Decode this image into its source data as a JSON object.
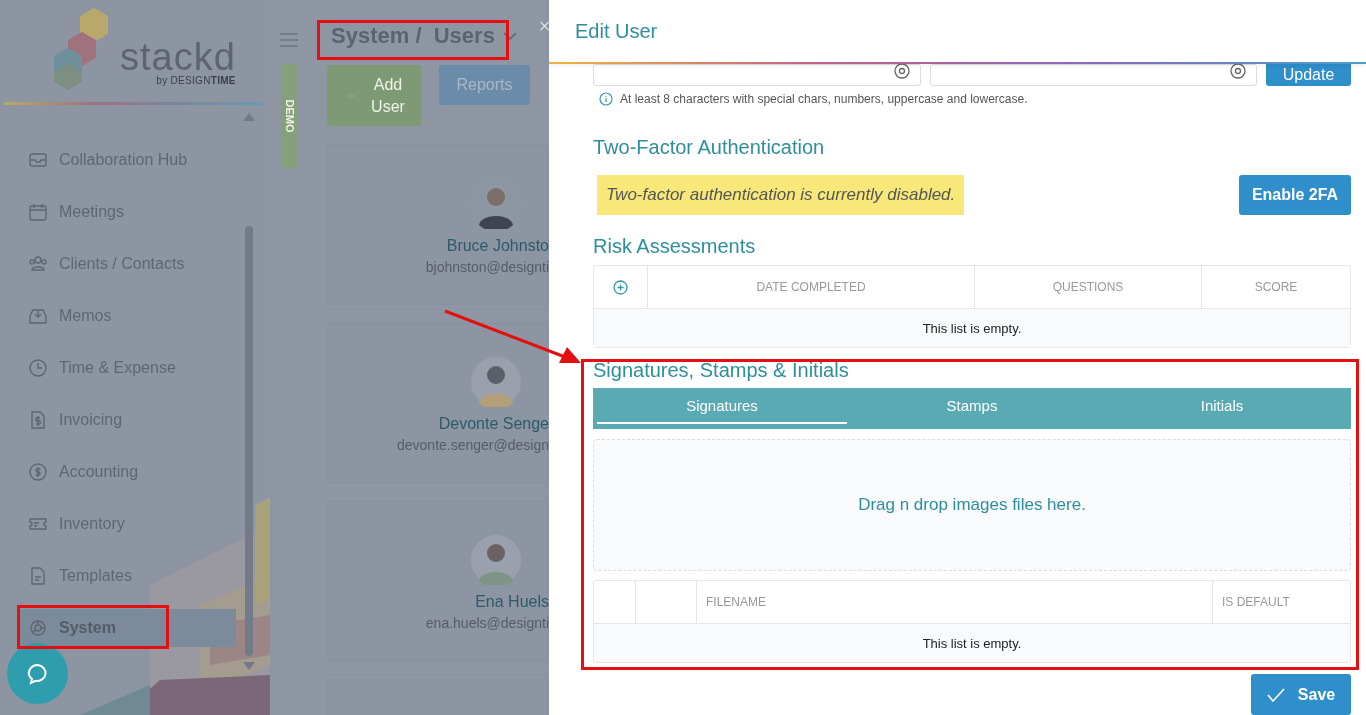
{
  "sidebar": {
    "logo": {
      "name": "stackd",
      "byline": "by DESIGN**TIME**"
    },
    "items": [
      {
        "label": "Collaboration Hub",
        "selected": false
      },
      {
        "label": "Meetings",
        "selected": false
      },
      {
        "label": "Clients / Contacts",
        "selected": false
      },
      {
        "label": "Memos",
        "selected": false
      },
      {
        "label": "Time & Expense",
        "selected": false
      },
      {
        "label": "Invoicing",
        "selected": false
      },
      {
        "label": "Accounting",
        "selected": false
      },
      {
        "label": "Inventory",
        "selected": false
      },
      {
        "label": "Templates",
        "selected": false
      },
      {
        "label": "System",
        "selected": true
      }
    ]
  },
  "demo_tab": "DEMO",
  "breadcrumb": "System /  Users",
  "buttons": [
    {
      "label": "Add User",
      "kind": "add"
    },
    {
      "label": "Reports",
      "kind": "plain"
    }
  ],
  "users": [
    {
      "name": "Bruce Johnsto",
      "email": "bjohnston@designti"
    },
    {
      "name": "Devonte Senge",
      "email": "devonte.senger@design"
    },
    {
      "name": "Ena Huels",
      "email": "ena.huels@designti"
    }
  ],
  "drawer": {
    "title": "Edit User",
    "update_button": "Update",
    "password_hint": "At least 8 characters with special chars, numbers, uppercase and lowercase.",
    "two_factor": {
      "heading": "Two-Factor Authentication",
      "status": "Two-factor authentication is currently disabled.",
      "button": "Enable 2FA"
    },
    "risk": {
      "heading": "Risk Assessments",
      "columns": [
        "DATE COMPLETED",
        "QUESTIONS",
        "SCORE"
      ],
      "empty": "This list is empty."
    },
    "signatures": {
      "heading": "Signatures, Stamps & Initials",
      "tabs": [
        {
          "label": "Signatures",
          "selected": true
        },
        {
          "label": "Stamps",
          "selected": false
        },
        {
          "label": "Initials",
          "selected": false
        }
      ],
      "dropzone": "Drag n drop images files here.",
      "columns": [
        "FILENAME",
        "IS DEFAULT"
      ],
      "empty": "This list is empty."
    },
    "save_button": "Save"
  }
}
